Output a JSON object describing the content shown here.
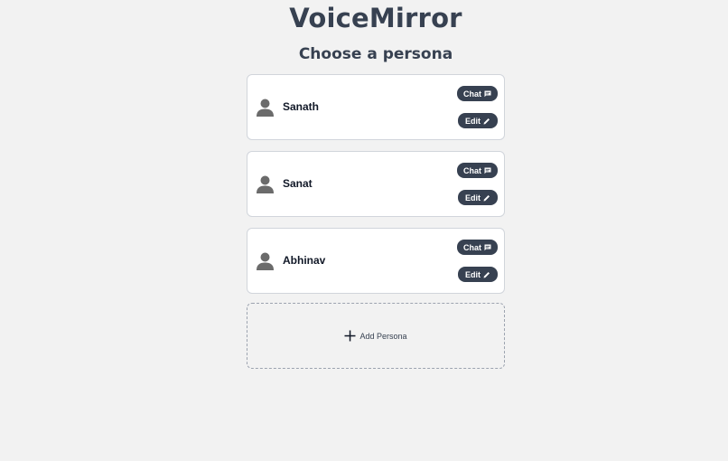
{
  "header": {
    "app_title": "VoiceMirror",
    "page_heading": "Choose a persona"
  },
  "personas": [
    {
      "name": "Sanath"
    },
    {
      "name": "Sanat"
    },
    {
      "name": "Abhinav"
    }
  ],
  "buttons": {
    "chat_label": "Chat",
    "edit_label": "Edit",
    "add_label": "Add Persona"
  },
  "icons": {
    "avatar": "user-icon",
    "chat": "chat-bubble-icon",
    "edit": "pencil-icon",
    "add": "plus-icon"
  },
  "colors": {
    "button_bg": "#374151",
    "page_bg": "#f2f2f2",
    "card_bg": "#ffffff",
    "avatar": "#6b6b6b"
  }
}
